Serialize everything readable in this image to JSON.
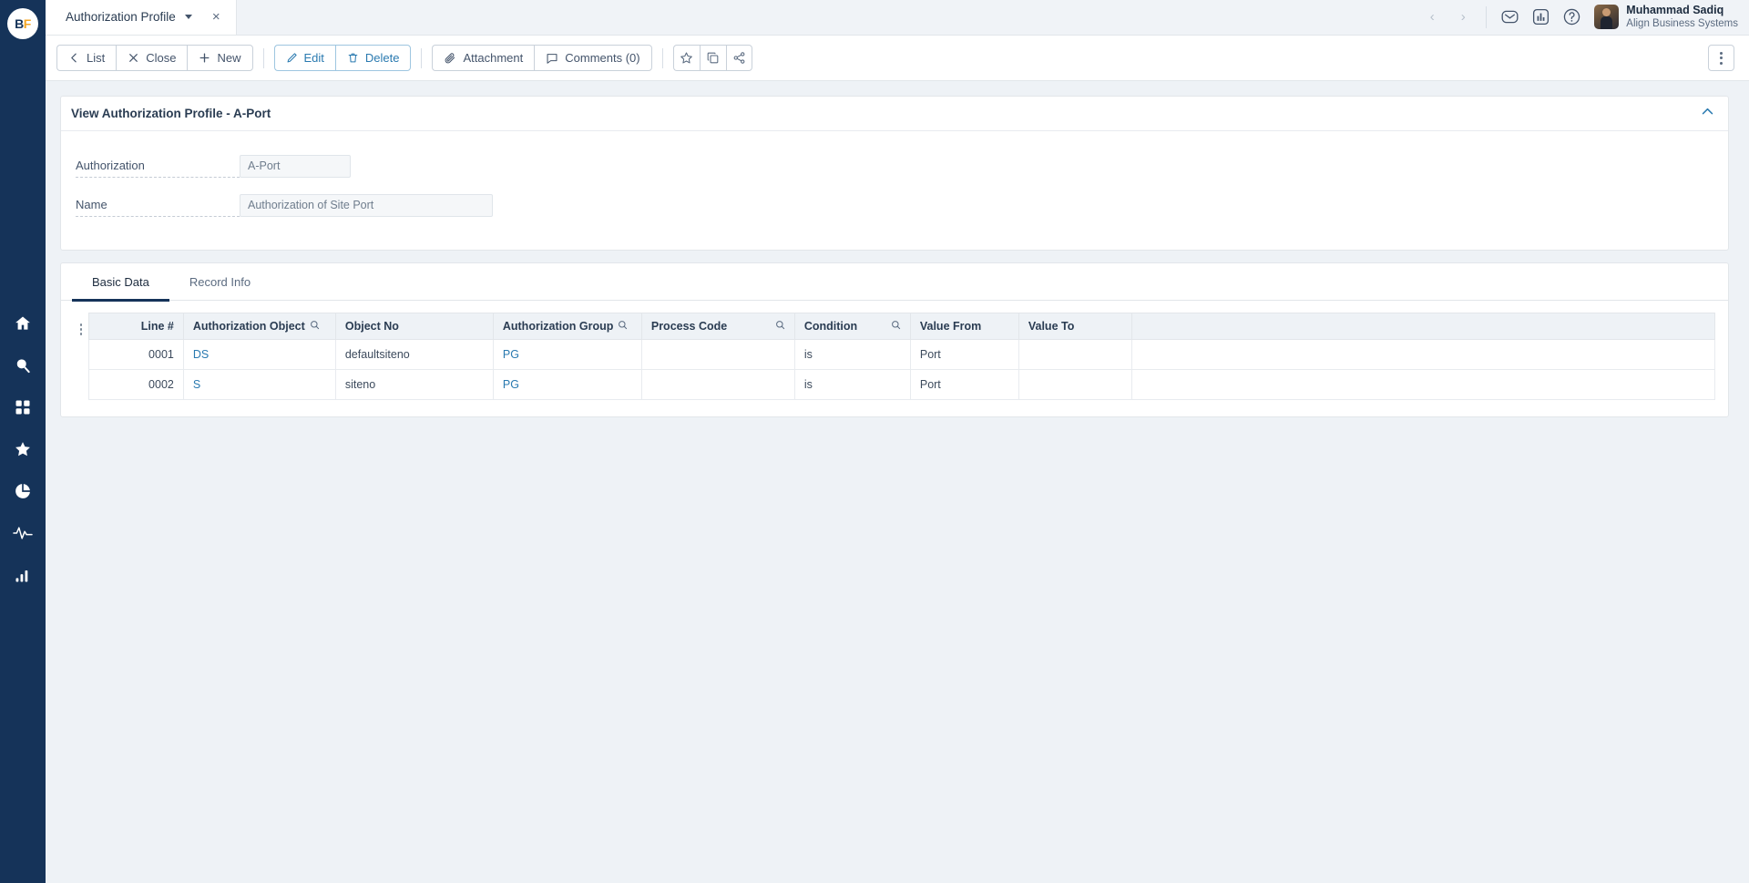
{
  "brand": {
    "logo_b": "B",
    "logo_f": "F",
    "accent_blue": "#2a7ab0",
    "rail_navy": "#153359"
  },
  "rail": {
    "items": [
      {
        "name": "home-icon",
        "label": "Home"
      },
      {
        "name": "search-icon",
        "label": "Search"
      },
      {
        "name": "apps-grid-icon",
        "label": "Apps"
      },
      {
        "name": "star-icon",
        "label": "Favorites"
      },
      {
        "name": "pie-chart-icon",
        "label": "Reports"
      },
      {
        "name": "activity-pulse-icon",
        "label": "Activity"
      },
      {
        "name": "bar-chart-icon",
        "label": "Analytics"
      }
    ]
  },
  "tabbar": {
    "document_tab": "Authorization Profile",
    "close_glyph": "×",
    "prev_glyph": "‹",
    "next_glyph": "›",
    "icons": [
      {
        "name": "mail-icon",
        "label": "Messages"
      },
      {
        "name": "chart-icon",
        "label": "Reports"
      },
      {
        "name": "help-icon",
        "label": "Help"
      }
    ],
    "user": {
      "name": "Muhammad Sadiq",
      "org": "Align Business Systems"
    }
  },
  "toolbar": {
    "list_label": "List",
    "close_label": "Close",
    "new_label": "New",
    "edit_label": "Edit",
    "delete_label": "Delete",
    "attachment_label": "Attachment",
    "comments_label": "Comments (0)",
    "icons": [
      {
        "name": "star-icon",
        "label": "Favorite"
      },
      {
        "name": "copy-icon",
        "label": "Copy"
      },
      {
        "name": "share-icon",
        "label": "Share"
      }
    ],
    "overflow_label": "More actions"
  },
  "panel": {
    "title": "View Authorization Profile - A-Port",
    "collapse_label": "Collapse"
  },
  "form": {
    "fields": [
      {
        "label": "Authorization",
        "value": "A-Port",
        "placeholder": "A-Port"
      },
      {
        "label": "Name",
        "value": "Authorization of Site Port",
        "placeholder": "Authorization of Site Port"
      }
    ]
  },
  "tabs": [
    {
      "label": "Basic Data",
      "active": true
    },
    {
      "label": "Record Info",
      "active": false
    }
  ],
  "grid": {
    "columns": [
      {
        "label": "Line #",
        "search": false,
        "align": "right"
      },
      {
        "label": "Authorization Object",
        "search": true,
        "align": "left"
      },
      {
        "label": "Object No",
        "search": false,
        "align": "left"
      },
      {
        "label": "Authorization Group",
        "search": true,
        "align": "left"
      },
      {
        "label": "Process Code",
        "search": true,
        "align": "left"
      },
      {
        "label": "Condition",
        "search": true,
        "align": "left"
      },
      {
        "label": "Value From",
        "search": false,
        "align": "left"
      },
      {
        "label": "Value To",
        "search": false,
        "align": "left"
      },
      {
        "label": "",
        "search": false,
        "align": "left"
      }
    ],
    "rows": [
      {
        "line": "0001",
        "authorization_object": "DS",
        "object_no": "defaultsiteno",
        "authorization_group": "PG",
        "process_code": "",
        "condition": "is",
        "value_from": "Port",
        "value_to": "",
        "extra": ""
      },
      {
        "line": "0002",
        "authorization_object": "S",
        "object_no": "siteno",
        "authorization_group": "PG",
        "process_code": "",
        "condition": "is",
        "value_from": "Port",
        "value_to": "",
        "extra": ""
      }
    ]
  }
}
